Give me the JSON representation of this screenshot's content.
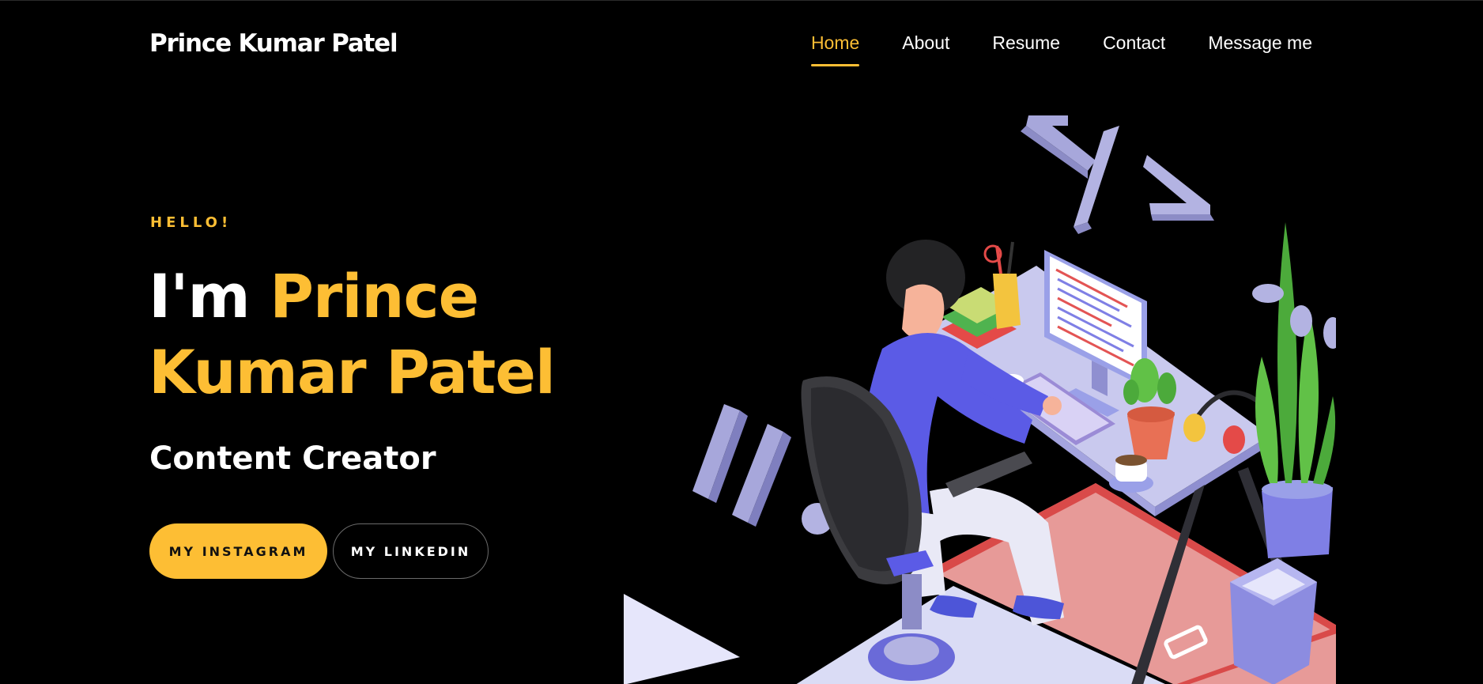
{
  "brand": "Prince Kumar Patel",
  "nav": {
    "items": [
      {
        "label": "Home",
        "active": true
      },
      {
        "label": "About",
        "active": false
      },
      {
        "label": "Resume",
        "active": false
      },
      {
        "label": "Contact",
        "active": false
      },
      {
        "label": "Message me",
        "active": false
      }
    ]
  },
  "hero": {
    "eyebrow": "HELLO!",
    "prefix": "I'm ",
    "name": "Prince Kumar Patel",
    "role": "Content Creator",
    "primary_button": "MY INSTAGRAM",
    "secondary_button": "MY LINKEDIN"
  },
  "colors": {
    "background": "#000000",
    "accent": "#fdbe34",
    "text": "#ffffff"
  },
  "illustration": {
    "icon": "developer-at-desk-illustration"
  }
}
